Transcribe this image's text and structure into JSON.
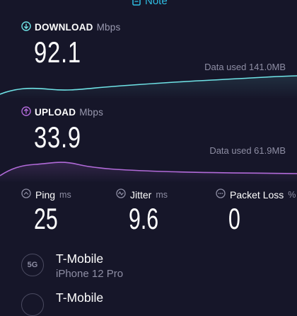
{
  "top": {
    "note_label": "Note"
  },
  "download": {
    "title": "DOWNLOAD",
    "unit": "Mbps",
    "value": "92.1",
    "data_used": "Data used 141.0MB",
    "color": "#6fe3e6"
  },
  "upload": {
    "title": "UPLOAD",
    "unit": "Mbps",
    "value": "33.9",
    "data_used": "Data used 61.9MB",
    "color": "#b16ad8"
  },
  "metrics": {
    "ping": {
      "title": "Ping",
      "unit": "ms",
      "value": "25"
    },
    "jitter": {
      "title": "Jitter",
      "unit": "ms",
      "value": "9.6"
    },
    "packet_loss": {
      "title": "Packet Loss",
      "unit": "%",
      "value": "0"
    }
  },
  "provider": {
    "badge": "5G",
    "name": "T-Mobile",
    "device": "iPhone 12 Pro",
    "second_name": "T-Mobile"
  },
  "colors": {
    "background": "#161629",
    "accent": "#2fbfe4",
    "muted": "#8e8ea4"
  }
}
